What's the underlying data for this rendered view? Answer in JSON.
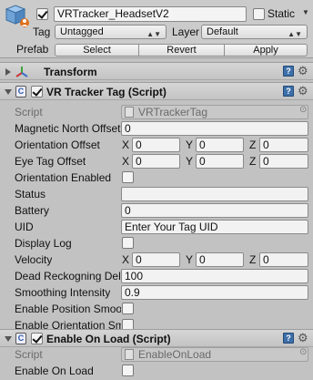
{
  "object": {
    "active": true,
    "name": "VRTracker_HeadsetV2",
    "static_label": "Static",
    "static_checked": false,
    "tag_label": "Tag",
    "tag_value": "Untagged",
    "layer_label": "Layer",
    "layer_value": "Default",
    "prefab_label": "Prefab",
    "prefab_buttons": [
      "Select",
      "Revert",
      "Apply"
    ]
  },
  "transform": {
    "title": "Transform",
    "expanded": false
  },
  "vr_tag": {
    "title": "VR Tracker Tag (Script)",
    "enabled": true,
    "script_label": "Script",
    "script_value": "VRTrackerTag",
    "magnetic_north_label": "Magnetic North Offset",
    "magnetic_north_value": "0",
    "orientation_offset_label": "Orientation Offset",
    "orientation_offset": {
      "x": "0",
      "y": "0",
      "z": "0"
    },
    "eye_tag_offset_label": "Eye Tag Offset",
    "eye_tag_offset": {
      "x": "0",
      "y": "0",
      "z": "0"
    },
    "orientation_enabled_label": "Orientation Enabled",
    "orientation_enabled": false,
    "status_label": "Status",
    "status_value": "",
    "battery_label": "Battery",
    "battery_value": "0",
    "uid_label": "UID",
    "uid_value": "Enter Your Tag UID",
    "display_log_label": "Display Log",
    "display_log": false,
    "velocity_label": "Velocity",
    "velocity": {
      "x": "0",
      "y": "0",
      "z": "0"
    },
    "dead_reckoning_label": "Dead Reckogning Dela",
    "dead_reckoning_value": "100",
    "smoothing_label": "Smoothing Intensity",
    "smoothing_value": "0.9",
    "enable_position_label": "Enable Position Smoot",
    "enable_position": false,
    "enable_orientation_label": "Enable Orientation Sm",
    "enable_orientation": false
  },
  "on_load": {
    "title": "Enable On Load (Script)",
    "enabled": true,
    "script_label": "Script",
    "script_value": "EnableOnLoad",
    "enable_on_load_label": "Enable On Load",
    "enable_on_load": false
  },
  "axes": {
    "x": "X",
    "y": "Y",
    "z": "Z"
  }
}
